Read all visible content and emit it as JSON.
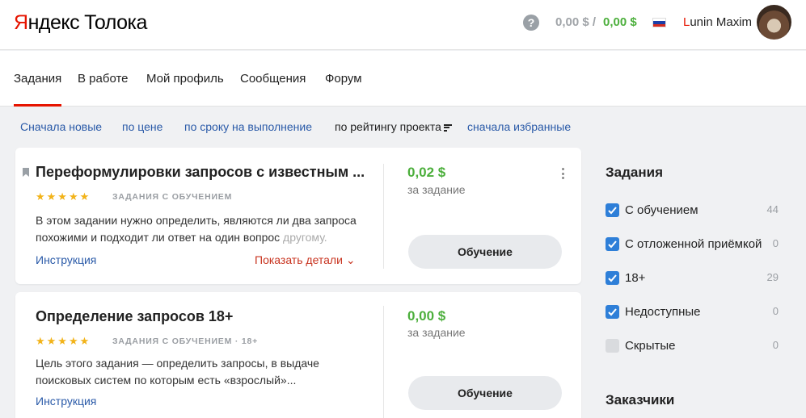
{
  "header": {
    "logo_brand_first": "Я",
    "logo_brand_rest": "ндекс",
    "logo_product": "Толока",
    "help_label": "?",
    "balance_pending": "0,00 $ /",
    "balance_available": "0,00 $",
    "user_first_letter": "L",
    "user_rest": "unin Maxim"
  },
  "nav": {
    "items": [
      "Задания",
      "В работе",
      "Мой профиль",
      "Сообщения",
      "Форум"
    ]
  },
  "sort": {
    "options": [
      "Сначала новые",
      "по цене",
      "по сроку на выполнение",
      "по рейтингу проекта",
      "сначала избранные"
    ]
  },
  "tasks": [
    {
      "title": "Переформулировки запросов с известным ...",
      "stars": "★★★★★",
      "tag": "ЗАДАНИЯ С ОБУЧЕНИЕМ",
      "desc_line1": "В этом задании нужно определить, являются ли два запроса",
      "desc_line2": "похожими и подходит ли ответ на один вопрос ",
      "desc_fade": "другому.",
      "instruction": "Инструкция",
      "details": "Показать детали ⌄",
      "price": "0,02 $",
      "per": "за задание",
      "button": "Обучение"
    },
    {
      "title": "Определение запросов 18+",
      "stars": "★★★★★",
      "tag": "ЗАДАНИЯ С ОБУЧЕНИЕМ   ·   18+",
      "desc_line1": "Цель этого задания — определить запросы, в выдаче",
      "desc_line2": "поисковых систем по которым есть «взрослый»...",
      "instruction": "Инструкция",
      "price": "0,00 $",
      "per": "за задание",
      "button": "Обучение"
    }
  ],
  "sidebar": {
    "title": "Задания",
    "filters": [
      {
        "label": "С обучением",
        "count": "44",
        "checked": true
      },
      {
        "label": "С отложенной приёмкой",
        "count": "0",
        "checked": true
      },
      {
        "label": "18+",
        "count": "29",
        "checked": true
      },
      {
        "label": "Недоступные",
        "count": "0",
        "checked": true
      },
      {
        "label": "Скрытые",
        "count": "0",
        "checked": false
      }
    ],
    "customers_title": "Заказчики"
  },
  "colors": {
    "brand_red": "#e61400",
    "link_blue": "#2a5aa8",
    "price_green": "#4caf3c",
    "checkbox_blue": "#2e7fd8"
  }
}
